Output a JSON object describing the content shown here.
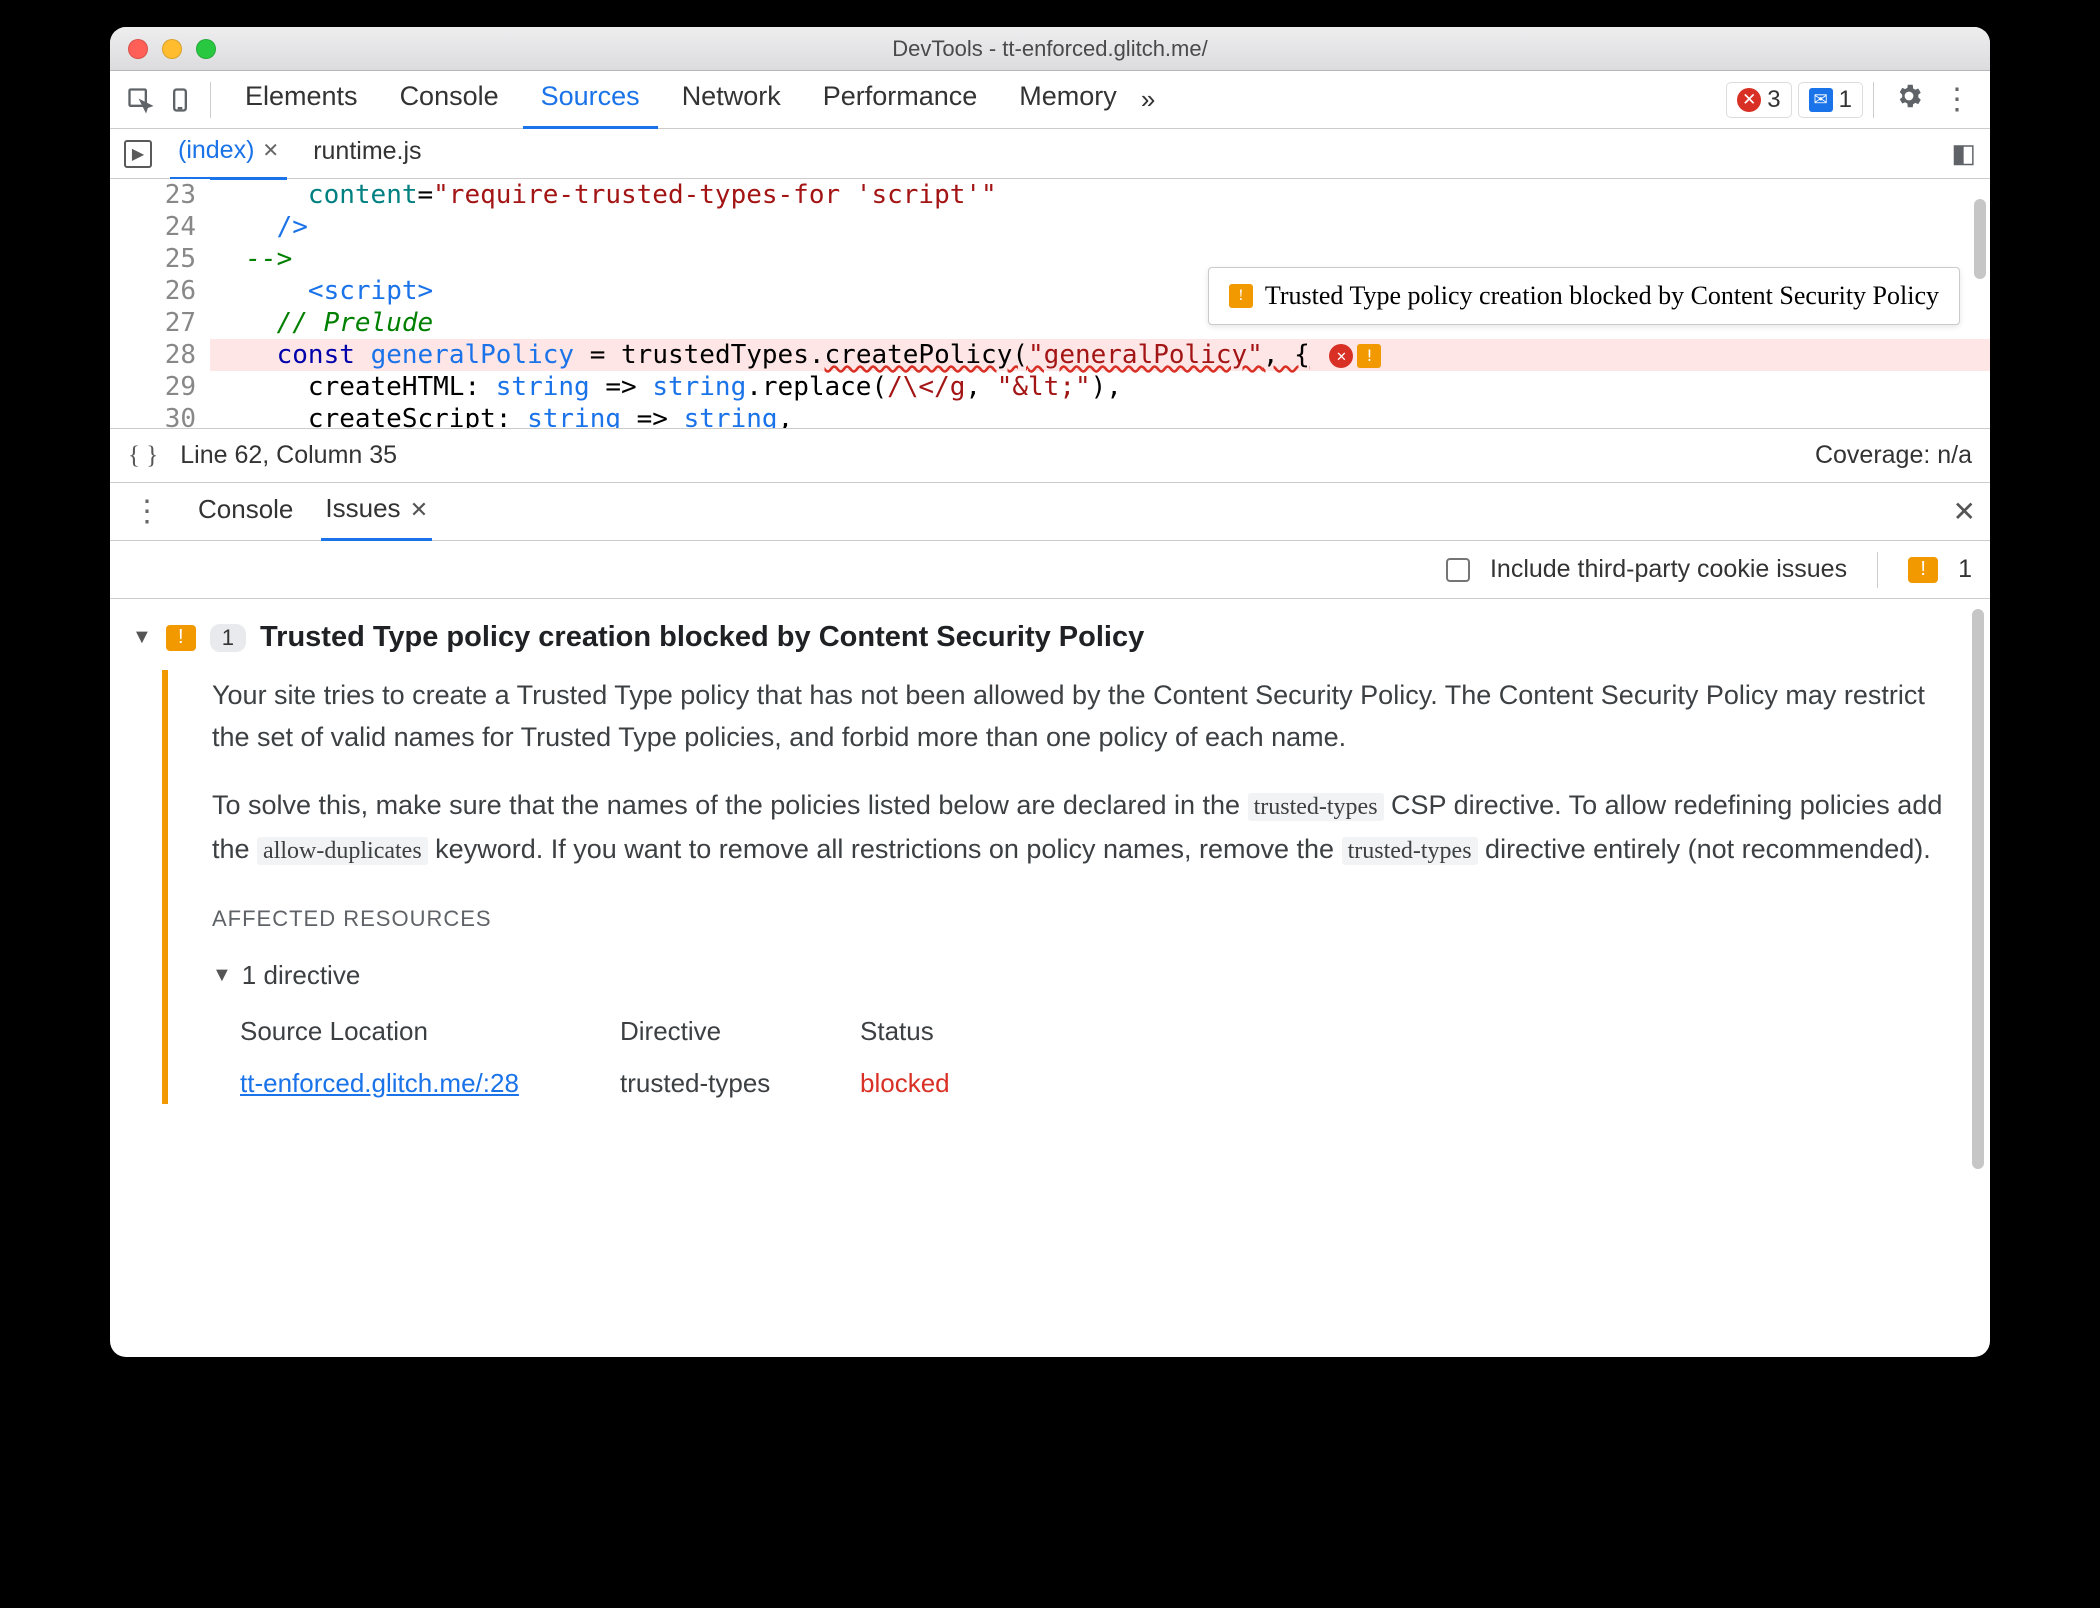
{
  "window": {
    "title": "DevTools - tt-enforced.glitch.me/"
  },
  "toolbar": {
    "tabs": [
      "Elements",
      "Console",
      "Sources",
      "Network",
      "Performance",
      "Memory"
    ],
    "active": "Sources",
    "more": "»",
    "errorCount": "3",
    "messageCount": "1"
  },
  "filetabs": {
    "items": [
      "(index)",
      "runtime.js"
    ],
    "active": "(index)"
  },
  "code": {
    "startLine": 23,
    "lines": [
      {
        "n": 23,
        "html": "      content=\"require-trusted-types-for 'script'\""
      },
      {
        "n": 24,
        "html": "    />"
      },
      {
        "n": 25,
        "html": "  -->"
      },
      {
        "n": 26,
        "html": "      <script>"
      },
      {
        "n": 27,
        "html": "    // Prelude"
      },
      {
        "n": 28,
        "html": "    const generalPolicy = trustedTypes.createPolicy(\"generalPolicy\", {",
        "hl": true
      },
      {
        "n": 29,
        "html": "      createHTML: string => string.replace(/\\</g, \"&lt;\"),"
      },
      {
        "n": 30,
        "html": "      createScript: string => string,"
      }
    ],
    "tooltip": "Trusted Type policy creation blocked by Content Security Policy"
  },
  "status": {
    "pos": "Line 62, Column 35",
    "coverage": "Coverage: n/a"
  },
  "lowtabs": {
    "items": [
      "Console",
      "Issues"
    ],
    "active": "Issues"
  },
  "filterrow": {
    "label": "Include third-party cookie issues",
    "warnCount": "1"
  },
  "nav": {
    "showpane": "◧"
  },
  "issue": {
    "count": "1",
    "title": "Trusted Type policy creation blocked by Content Security Policy",
    "p1a": "Your site tries to create a Trusted Type policy that has not been allowed by the Content Security Policy. The Content Security Policy may restrict the set of valid names for Trusted Type policies, and forbid more than one policy of each name.",
    "p2_pre": "To solve this, make sure that the names of the policies listed below are declared in the ",
    "p2_c1": "trusted-types",
    "p2_mid1": " CSP directive. To allow redefining policies add the ",
    "p2_c2": "allow-duplicates",
    "p2_mid2": " keyword. If you want to remove all restrictions on policy names, remove the ",
    "p2_c3": "trusted-types",
    "p2_post": " directive entirely (not recommended).",
    "affected": "AFFECTED RESOURCES",
    "dircount": "1 directive",
    "th1": "Source Location",
    "th2": "Directive",
    "th3": "Status",
    "src": "tt-enforced.glitch.me/:28",
    "dir": "trusted-types",
    "status": "blocked"
  }
}
